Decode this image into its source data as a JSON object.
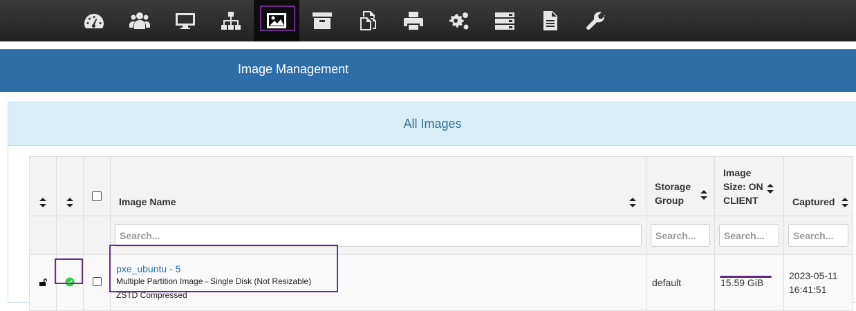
{
  "nav": {
    "items": [
      {
        "name": "dashboard-icon"
      },
      {
        "name": "users-icon"
      },
      {
        "name": "monitor-icon"
      },
      {
        "name": "network-tree-icon"
      },
      {
        "name": "image-icon",
        "active": true
      },
      {
        "name": "archive-icon"
      },
      {
        "name": "copy-icon"
      },
      {
        "name": "printer-icon"
      },
      {
        "name": "gears-icon"
      },
      {
        "name": "server-icon"
      },
      {
        "name": "file-icon"
      },
      {
        "name": "wrench-icon"
      }
    ]
  },
  "header": {
    "title": "Image Management"
  },
  "panel": {
    "title": "All Images"
  },
  "table": {
    "columns": {
      "image_name": "Image Name",
      "storage_group_1": "Storage",
      "storage_group_2": "Group",
      "image_size_1": "Image",
      "image_size_2": "Size: ON",
      "image_size_3": "CLIENT",
      "captured": "Captured"
    },
    "filters": {
      "image_name": "Search...",
      "storage_group": "Search...",
      "image_size": "Search...",
      "captured": "Search..."
    },
    "rows": [
      {
        "name": "pxe_ubuntu - 5",
        "type": "Multiple Partition Image - Single Disk (Not Resizable)",
        "compression": "ZSTD Compressed",
        "storage_group": "default",
        "size": "15.59 GiB",
        "captured_date": "2023-05-11",
        "captured_time": "16:41:51",
        "locked": false,
        "enabled": true
      }
    ]
  },
  "colors": {
    "accent": "#2d6ea8",
    "highlight": "#6a2c8a",
    "ok": "#2ecc40"
  }
}
